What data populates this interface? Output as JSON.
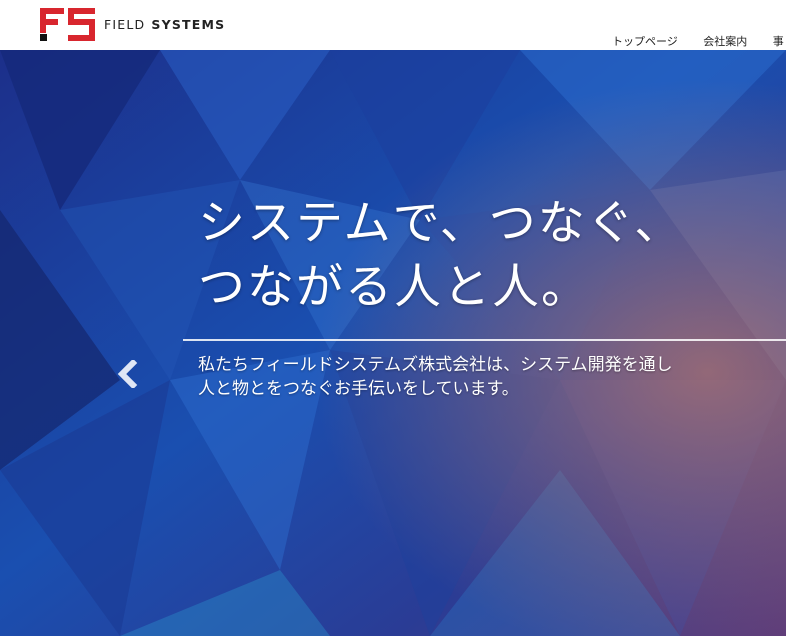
{
  "header": {
    "brand_primary": "FIELD",
    "brand_secondary": "SYSTEMS",
    "logo_color": "#d8262e",
    "nav": [
      {
        "label": "トップページ"
      },
      {
        "label": "会社案内"
      },
      {
        "label": "事"
      }
    ]
  },
  "hero": {
    "headline_line1": "システムで、つなぐ、",
    "headline_line2": "つながる人と人。",
    "description_line1": "私たちフィールドシステムズ株式会社は、システム開発を通し",
    "description_line2": "人と物とをつなぐお手伝いをしています。",
    "prev_icon": "chevron-left-icon"
  }
}
